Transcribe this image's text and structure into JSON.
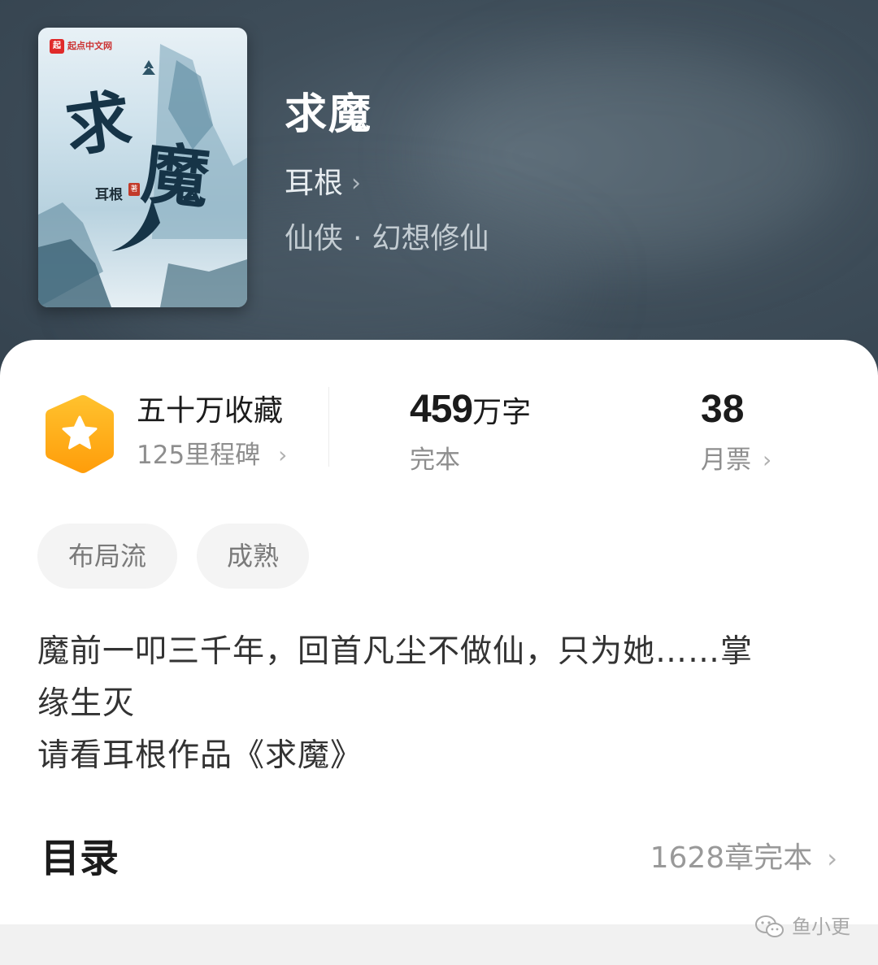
{
  "book": {
    "title": "求魔",
    "author": "耳根",
    "genre": "仙侠",
    "subgenre": "幻想修仙",
    "separator": "·"
  },
  "cover": {
    "publisher_badge": "起",
    "publisher": "起点中文网",
    "title_char_1": "求",
    "title_char_2": "魔",
    "author": "耳根",
    "seal": "著"
  },
  "stats": {
    "collections": "五十万收藏",
    "milestones": "125里程碑",
    "word_count_number": "459",
    "word_count_unit": "万字",
    "status": "完本",
    "monthly_votes": "38",
    "monthly_votes_label": "月票"
  },
  "tags": [
    "布局流",
    "成熟"
  ],
  "description": {
    "line1": "魔前一叩三千年，回首凡尘不做仙，只为她……掌",
    "line2": "缘生灭",
    "line3": "请看耳根作品《求魔》"
  },
  "toc": {
    "label": "目录",
    "summary": "1628章完本"
  },
  "watermark": "鱼小更",
  "colors": {
    "hero_bg": "#3f4e5a",
    "badge_orange": "#ffb11b",
    "tag_bg": "#f4f4f4"
  }
}
